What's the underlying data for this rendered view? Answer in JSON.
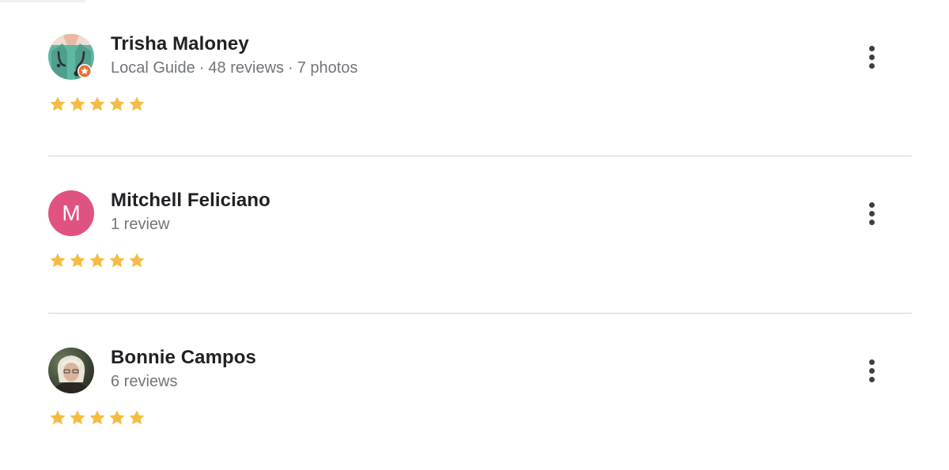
{
  "reviews": [
    {
      "name": "Trisha Maloney",
      "meta": [
        "Local Guide",
        "48 reviews",
        "7 photos"
      ],
      "meta_separator": "·",
      "avatar": {
        "type": "illustration",
        "icon": "doctor-avatar-icon",
        "badge": "local-guide-star-badge-icon",
        "bg": "#5fb8a4"
      },
      "rating": 5,
      "star_color": "#f4bc42"
    },
    {
      "name": "Mitchell Feliciano",
      "meta": [
        "1 review"
      ],
      "meta_separator": "·",
      "avatar": {
        "type": "letter",
        "letter": "M",
        "bg": "#e05280"
      },
      "rating": 5,
      "star_color": "#f4bc42"
    },
    {
      "name": "Bonnie Campos",
      "meta": [
        "6 reviews"
      ],
      "meta_separator": "·",
      "avatar": {
        "type": "photo",
        "icon": "profile-photo-avatar"
      },
      "rating": 5,
      "star_color": "#f4bc42"
    }
  ]
}
